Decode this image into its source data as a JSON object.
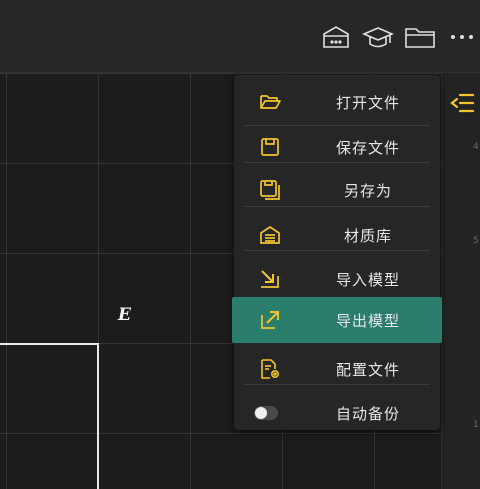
{
  "colors": {
    "accent": "#f2c530",
    "active_bg": "#2b7d6c"
  },
  "toolbar": {
    "icons": [
      "rack-icon",
      "graduation-cap-icon",
      "folder-icon",
      "more-icon"
    ]
  },
  "canvas": {
    "point_label": "E"
  },
  "menu": {
    "items": [
      {
        "label": "打开文件",
        "icon": "folder-open-icon"
      },
      {
        "label": "保存文件",
        "icon": "save-icon"
      },
      {
        "label": "另存为",
        "icon": "save-as-icon"
      },
      {
        "label": "材质库",
        "icon": "material-library-icon"
      },
      {
        "label": "导入模型",
        "icon": "import-icon"
      },
      {
        "label": "导出模型",
        "icon": "export-icon",
        "active": true
      },
      {
        "label": "配置文件",
        "icon": "config-file-icon"
      },
      {
        "label": "自动备份",
        "icon": "toggle-switch",
        "toggle_on": false
      }
    ]
  }
}
